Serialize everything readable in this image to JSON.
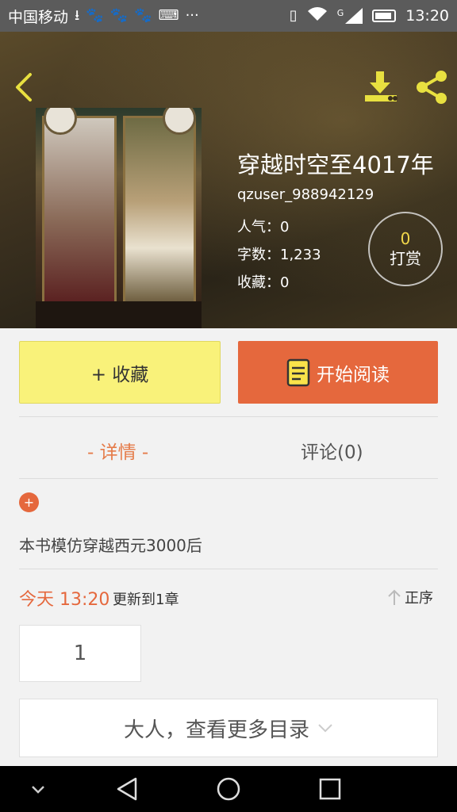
{
  "status_bar": {
    "carrier": "中国移动",
    "time": "13:20",
    "network": "G"
  },
  "header": {
    "title": "穿越时空至4017年",
    "author": "qzuser_988942129",
    "popularity": "人气：0",
    "word_count": "字数：1,233",
    "favorites": "收藏：0",
    "reward_count": "0",
    "reward_label": "打赏"
  },
  "actions": {
    "favorite_label": "+ 收藏",
    "read_label": "开始阅读"
  },
  "tabs": [
    {
      "label": "- 详情 -",
      "active": true
    },
    {
      "label": "评论(0)",
      "active": false
    }
  ],
  "details": {
    "expand_label": "+",
    "description": "本书模仿穿越西元3000后",
    "update_time": "今天 13:20",
    "update_text": "更新到1章",
    "sort_label": "正序"
  },
  "chapters": [
    {
      "label": "1"
    }
  ],
  "more_catalog_label": "大人，查看更多目录",
  "colors": {
    "accent": "#e5683d",
    "favorite_bg": "#f9f27a",
    "reward_count": "#f2d74a",
    "back_icon": "#e8e040"
  },
  "icons": [
    "back-arrow-icon",
    "download-icon",
    "share-icon",
    "book-icon",
    "arrow-up-icon",
    "chevron-down-icon",
    "nav-back-icon",
    "nav-home-icon",
    "nav-recent-icon",
    "nav-down-icon"
  ]
}
